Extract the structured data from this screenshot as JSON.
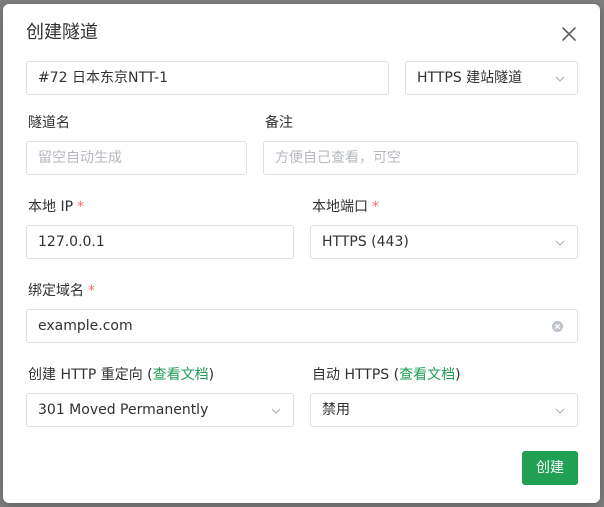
{
  "dialog": {
    "title": "创建隧道",
    "close_icon": "close-icon"
  },
  "node_select": {
    "value": "#72 日本东京NTT-1"
  },
  "type_select": {
    "value": "HTTPS 建站隧道"
  },
  "tunnel_name": {
    "label": "隧道名",
    "placeholder": "留空自动生成"
  },
  "remark": {
    "label": "备注",
    "placeholder": "方便自己查看，可空"
  },
  "local_ip": {
    "label": "本地 IP",
    "required_mark": "*",
    "value": "127.0.0.1"
  },
  "local_port": {
    "label": "本地端口",
    "required_mark": "*",
    "value": "HTTPS (443)"
  },
  "domain": {
    "label": "绑定域名",
    "required_mark": "*",
    "value": "example.com"
  },
  "http_redirect": {
    "label_prefix": "创建 HTTP 重定向 (",
    "link": "查看文档",
    "label_suffix": ")",
    "value": "301 Moved Permanently"
  },
  "auto_https": {
    "label_prefix": "自动 HTTPS (",
    "link": "查看文档",
    "label_suffix": ")",
    "value": "禁用"
  },
  "create_button": {
    "label": "创建"
  },
  "colors": {
    "accent": "#20a053",
    "link": "#1e9e54",
    "required": "#f56c6c",
    "border": "#dcdfe6"
  }
}
